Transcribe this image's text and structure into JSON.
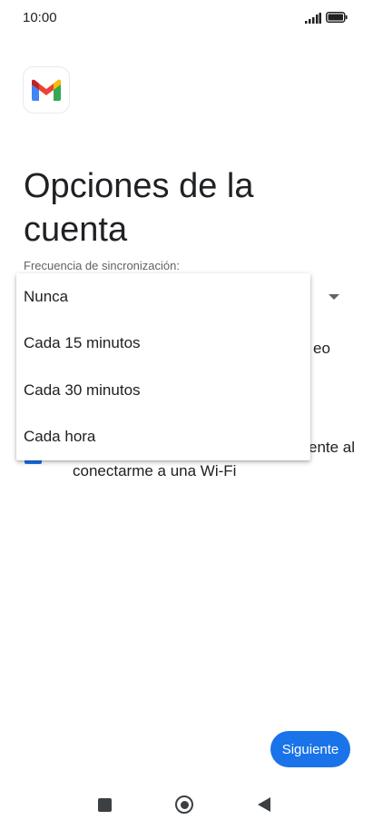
{
  "status_bar": {
    "time": "10:00",
    "signal_icon": "signal-icon",
    "battery_icon": "battery-icon"
  },
  "logo": {
    "icon": "gmail-logo-icon",
    "colors": [
      "#ea4335",
      "#4285f4",
      "#34a853",
      "#fbbc04",
      "#c5221f"
    ]
  },
  "title": "Opciones de la cuenta",
  "sync": {
    "label": "Frecuencia de sincronización:",
    "dropdown_options": [
      "Nunca",
      "Cada 15 minutos",
      "Cada 30 minutos",
      "Cada hora"
    ]
  },
  "background_fragments": {
    "option_fragment": "eo",
    "wifi_fragment": "ente al"
  },
  "wifi_option": {
    "checked": true,
    "text_visible": "conectarme a una Wi-Fi"
  },
  "next_button": "Siguiente",
  "nav": {
    "recents_icon": "square-recents-icon",
    "home_icon": "circle-home-icon",
    "back_icon": "triangle-back-icon"
  },
  "colors": {
    "accent": "#1a73e8",
    "text": "#202124",
    "secondary_text": "#5f6368"
  }
}
